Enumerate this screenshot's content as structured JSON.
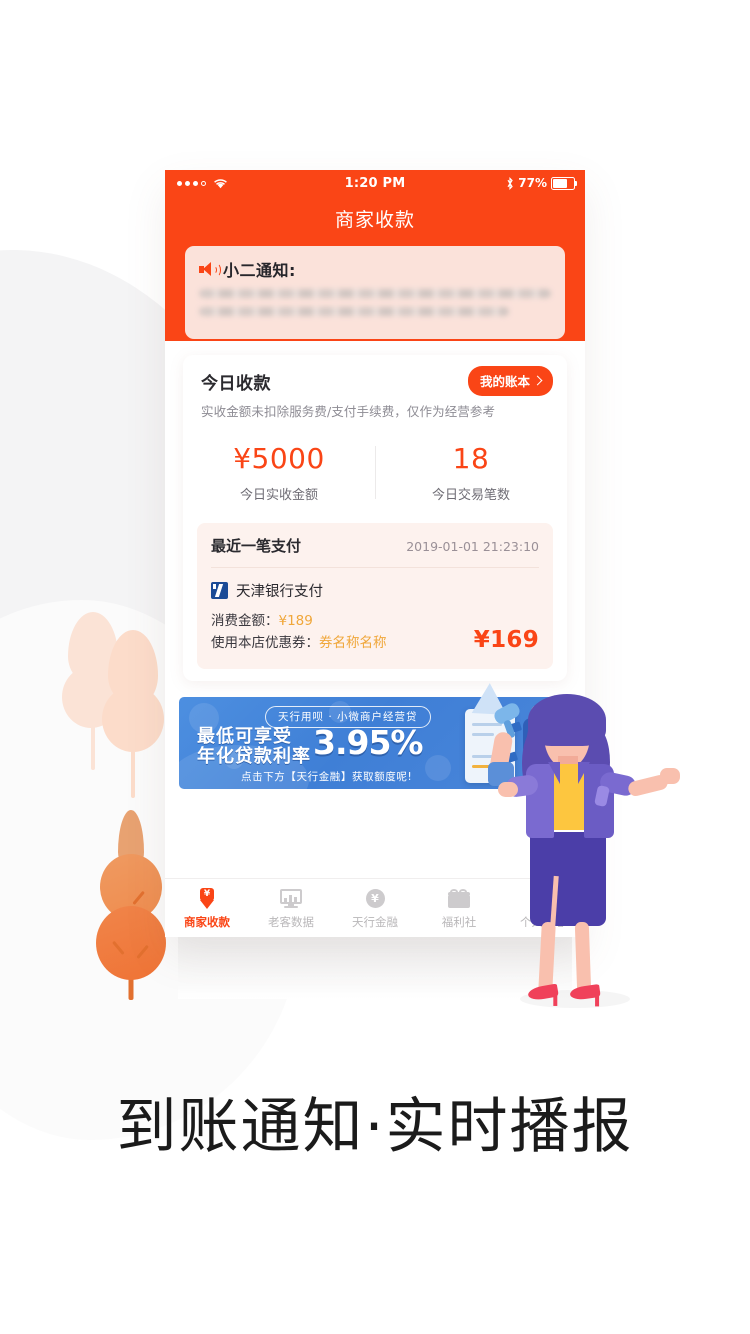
{
  "colors": {
    "brand_orange": "#FA4516",
    "notice_bg": "#FBE2DA",
    "recent_bg": "#FDF2EE",
    "banner_blue": "#4A86DA",
    "bank_navy": "#1C4B96",
    "coupon_gold": "#F0A73A",
    "tab_inactive": "#B9B7B9"
  },
  "status_bar": {
    "signal_icon": "signal-dots-icon",
    "wifi_icon": "wifi-icon",
    "time": "1:20 PM",
    "bluetooth_icon": "bluetooth-icon",
    "battery_percent": "77%",
    "battery_icon": "battery-icon"
  },
  "nav": {
    "title": "商家收款"
  },
  "notice": {
    "icon": "speaker-icon",
    "title": "小二通知:",
    "body_redacted": true,
    "body_lines": [
      "",
      ""
    ]
  },
  "today_card": {
    "title": "今日收款",
    "subtitle": "实收金额未扣除服务费/支付手续费，仅作为经营参考",
    "ledger_button": "我的账本",
    "ledger_chevron_icon": "chevron-right-icon",
    "stats": [
      {
        "value": "¥5000",
        "label": "今日实收金额"
      },
      {
        "value": "18",
        "label": "今日交易笔数"
      }
    ]
  },
  "recent_payment": {
    "title": "最近一笔支付",
    "timestamp": "2019-01-01 21:23:10",
    "bank_icon": "tianjin-bank-logo-icon",
    "bank_name": "天津银行支付",
    "amount_label": "消费金额：",
    "amount_value": "¥189",
    "coupon_label": "使用本店优惠券：",
    "coupon_value": "券名称名称",
    "net_amount": "¥169"
  },
  "banner": {
    "pill": "天行用呗 · 小微商户经营贷",
    "headline_line1": "最低可享受",
    "headline_line2": "年化贷款利率",
    "rate": "3.95%",
    "subline": "点击下方【天行金融】获取额度呢!",
    "art_icon": "loan-illustration-icon"
  },
  "tabbar": {
    "items": [
      {
        "label": "商家收款",
        "icon": "money-arrow-down-icon",
        "active": true
      },
      {
        "label": "老客数据",
        "icon": "bar-chart-monitor-icon",
        "active": false
      },
      {
        "label": "天行金融",
        "icon": "yen-circle-icon",
        "active": false
      },
      {
        "label": "福利社",
        "icon": "gift-box-icon",
        "active": false
      },
      {
        "label": "个人中心",
        "icon": "person-icon",
        "active": false
      }
    ]
  },
  "illustration": {
    "woman_icon": "woman-pointing-icon",
    "megaphone_icon": "megaphone-icon",
    "tree_icons": [
      "leaf-tree-pale-icon",
      "leaf-tree-pale-icon",
      "leaf-tree-orange-icon"
    ]
  },
  "caption": {
    "text": "到账通知·实时播报"
  }
}
